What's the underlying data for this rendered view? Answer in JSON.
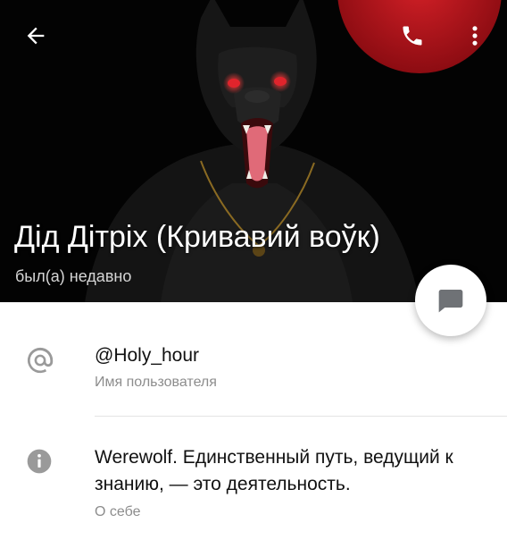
{
  "profile": {
    "name": "Дід Дітріх (Кривавий воўк)",
    "status": "был(а) недавно"
  },
  "username": {
    "value": "@Holy_hour",
    "label": "Имя пользователя"
  },
  "bio": {
    "line1": "Werewolf. Единственный путь, ведущий к",
    "line2": "знанию, — это деятельность.",
    "label": "О себе"
  },
  "icons": {
    "back": "arrow-left-icon",
    "call": "phone-icon",
    "menu": "more-vertical-icon",
    "message": "chat-bubble-icon",
    "username": "at-sign-icon",
    "info": "info-icon"
  },
  "colors": {
    "header_bg": "#030303",
    "moon": "#b9161c",
    "eyes": "#e0242c",
    "icon_gray": "#9a9a9a",
    "fab_icon": "#6f7276"
  }
}
